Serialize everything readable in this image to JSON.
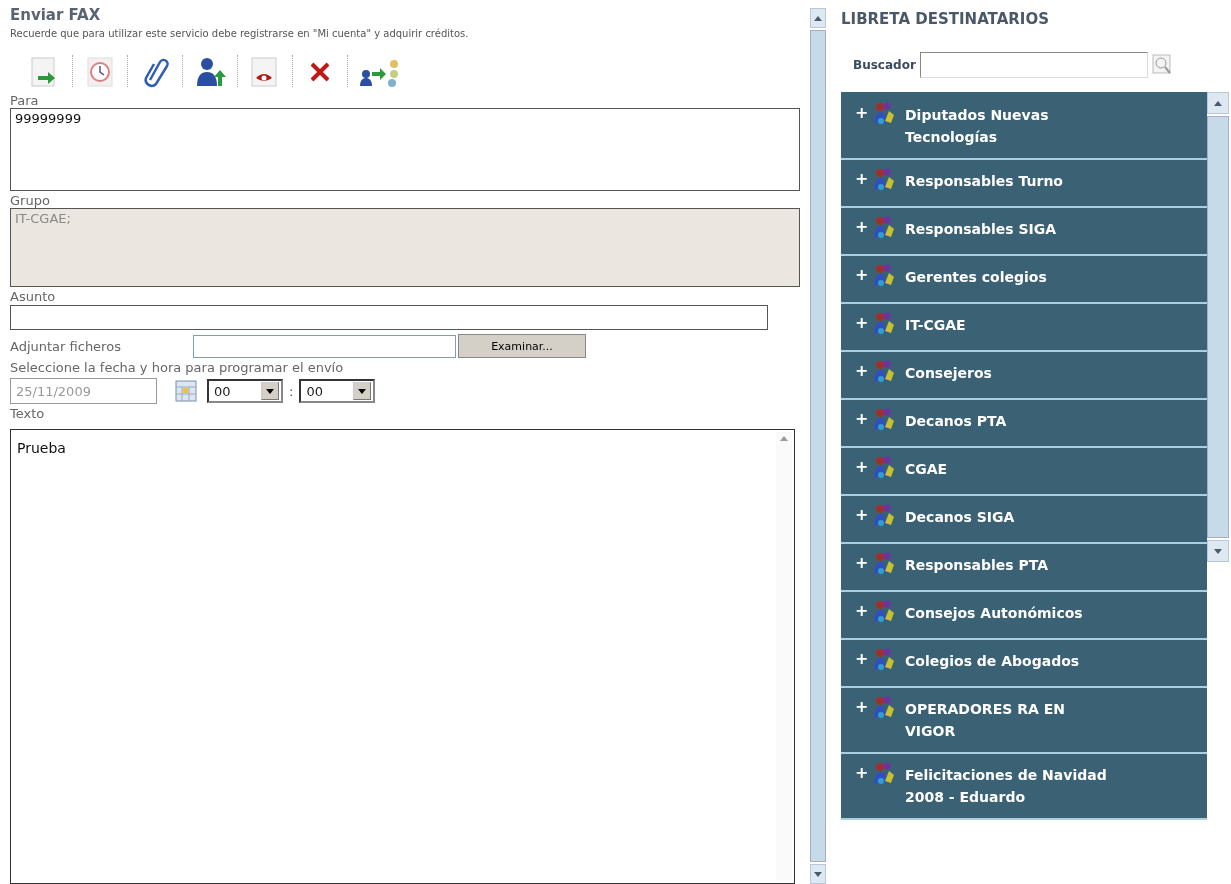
{
  "compose": {
    "title": "Enviar FAX",
    "note": "Recuerde que para utilizar este servicio debe registrarse en \"Mi cuenta\" y adquirir créditos.",
    "to": {
      "label": "Para",
      "value": "99999999"
    },
    "group": {
      "label": "Grupo",
      "value": "IT-CGAE;",
      "disabled": true
    },
    "subject": {
      "label": "Asunto"
    },
    "attach": {
      "label": "Adjuntar ficheros",
      "button": "Examinar..."
    },
    "schedule": {
      "label": "Seleccione la fecha y hora para programar el envío",
      "date": "25/11/2009",
      "hour": "00",
      "separator": ":",
      "minute": "00"
    },
    "body": {
      "label": "Texto",
      "value": "Prueba"
    }
  },
  "address_book": {
    "title": "LIBRETA DESTINATARIOS",
    "search": {
      "label": "Buscador"
    },
    "items": [
      {
        "expander": "+",
        "label": "Diputados Nuevas Tecnologías"
      },
      {
        "expander": "+",
        "label": "Responsables Turno"
      },
      {
        "expander": "+",
        "label": "Responsables SIGA"
      },
      {
        "expander": "+",
        "label": "Gerentes colegios"
      },
      {
        "expander": "+",
        "label": "IT-CGAE"
      },
      {
        "expander": "+",
        "label": "Consejeros"
      },
      {
        "expander": "+",
        "label": "Decanos PTA"
      },
      {
        "expander": "+",
        "label": "CGAE"
      },
      {
        "expander": "+",
        "label": "Decanos SIGA"
      },
      {
        "expander": "+",
        "label": "Responsables PTA"
      },
      {
        "expander": "+",
        "label": "Consejos Autonómicos"
      },
      {
        "expander": "+",
        "label": "Colegios de Abogados"
      },
      {
        "expander": "+",
        "label": "OPERADORES RA EN VIGOR"
      },
      {
        "expander": "+",
        "label": "Felicitaciones de Navidad 2008 - Eduardo"
      }
    ]
  }
}
